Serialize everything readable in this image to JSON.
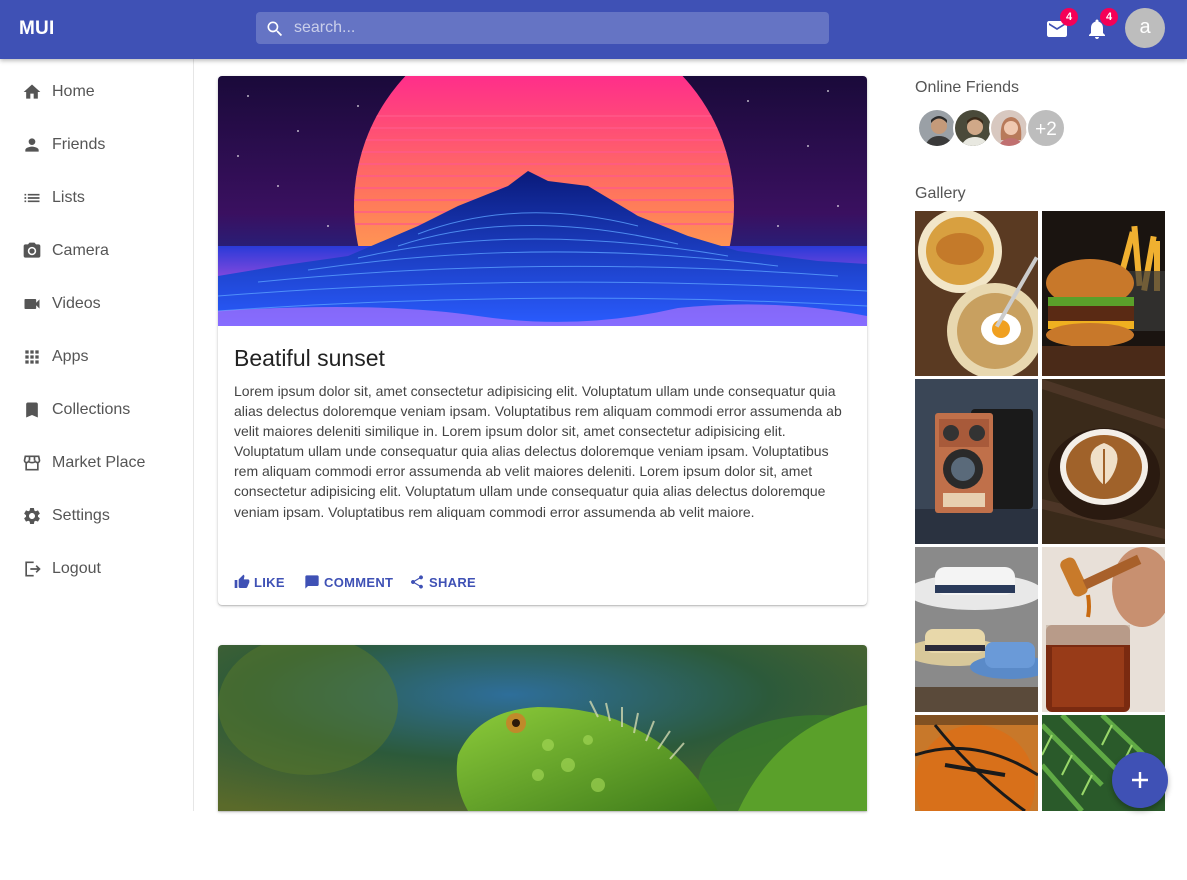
{
  "appbar": {
    "logo": "MUI",
    "search_placeholder": "search...",
    "mail_badge": "4",
    "notifications_badge": "4",
    "avatar_letter": "a",
    "color": "#3f51b5"
  },
  "sidebar": {
    "items": [
      {
        "label": "Home",
        "icon": "home-icon"
      },
      {
        "label": "Friends",
        "icon": "person-icon"
      },
      {
        "label": "Lists",
        "icon": "list-icon"
      },
      {
        "label": "Camera",
        "icon": "camera-icon"
      },
      {
        "label": "Videos",
        "icon": "videocam-icon"
      },
      {
        "label": "Apps",
        "icon": "apps-icon"
      },
      {
        "label": "Collections",
        "icon": "bookmark-icon"
      },
      {
        "label": "Market Place",
        "icon": "storefront-icon"
      },
      {
        "label": "Settings",
        "icon": "settings-icon"
      },
      {
        "label": "Logout",
        "icon": "logout-icon"
      }
    ]
  },
  "posts": [
    {
      "image": "synthwave-sunset-mountain",
      "title": "Beatiful sunset",
      "text": "Lorem ipsum dolor sit, amet consectetur adipisicing elit. Voluptatum ullam unde consequatur quia alias delectus doloremque veniam ipsam. Voluptatibus rem aliquam commodi error assumenda ab velit maiores deleniti similique in. Lorem ipsum dolor sit, amet consectetur adipisicing elit. Voluptatum ullam unde consequatur quia alias delectus doloremque veniam ipsam. Voluptatibus rem aliquam commodi error assumenda ab velit maiores deleniti. Lorem ipsum dolor sit, amet consectetur adipisicing elit. Voluptatum ullam unde consequatur quia alias delectus doloremque veniam ipsam. Voluptatibus rem aliquam commodi error assumenda ab velit maiore.",
      "actions": {
        "like": "LIKE",
        "comment": "COMMENT",
        "share": "SHARE"
      }
    },
    {
      "image": "green-iguana"
    }
  ],
  "right_panel": {
    "online_friends_title": "Online Friends",
    "friends_more": "+2",
    "gallery_title": "Gallery",
    "gallery": [
      "breakfast-plates",
      "burger-fries",
      "vintage-camera",
      "latte-art",
      "straw-hats",
      "honey-jar",
      "basketball",
      "fern-leaves"
    ]
  }
}
